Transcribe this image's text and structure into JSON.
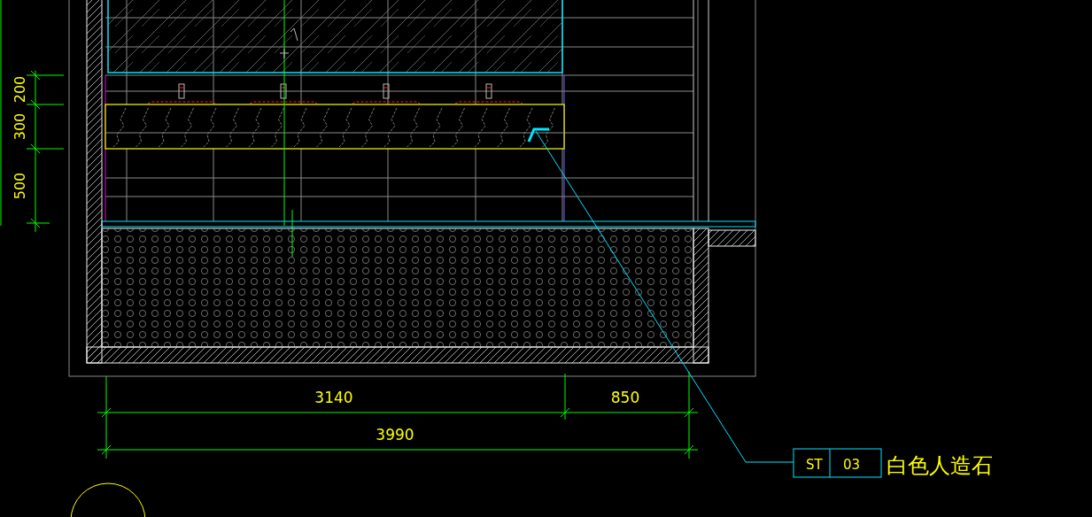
{
  "vertical_dimensions": [
    "200",
    "300",
    "500"
  ],
  "horizontal_dimensions": {
    "segments": [
      "3140",
      "850"
    ],
    "total": "3990"
  },
  "material_tag": {
    "code": "ST",
    "number": "03",
    "material": "白色人造石"
  }
}
